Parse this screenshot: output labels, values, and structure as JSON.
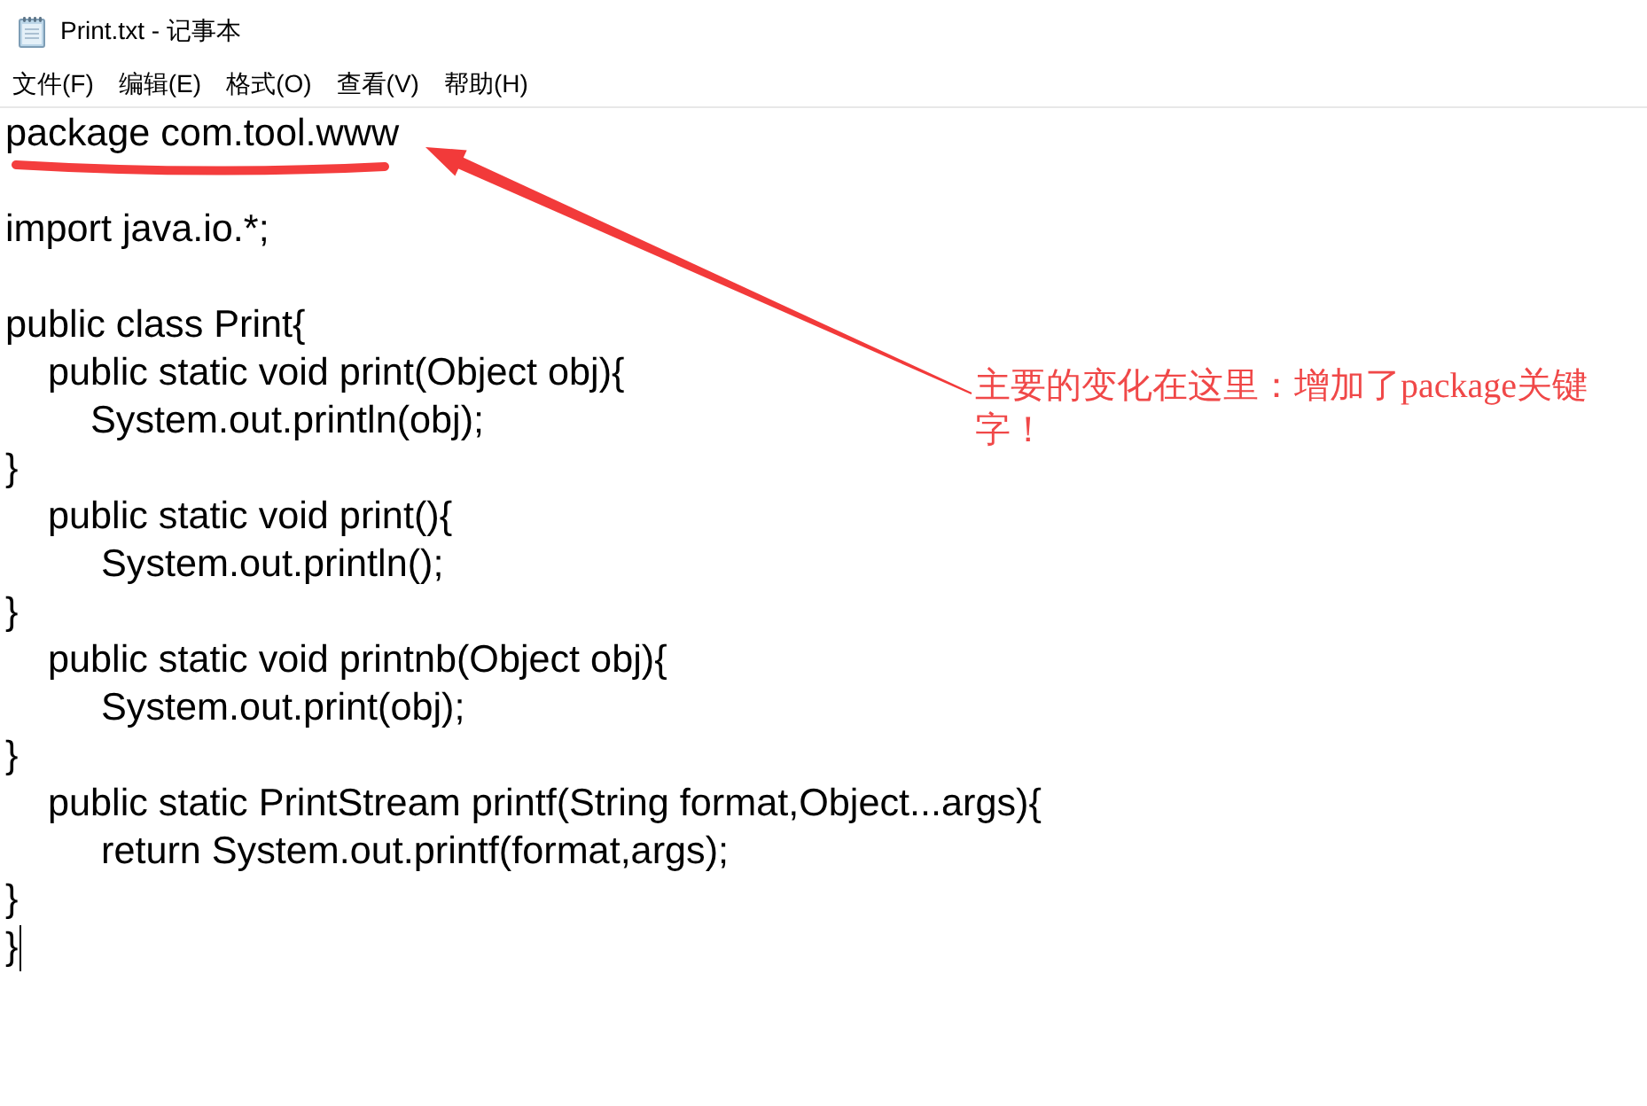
{
  "window": {
    "title": "Print.txt - 记事本"
  },
  "menu": [
    "文件(F)",
    "编辑(E)",
    "格式(O)",
    "查看(V)",
    "帮助(H)"
  ],
  "editor": {
    "caret": true,
    "blocks": [
      [
        "package com.tool.www"
      ],
      [
        "import java.io.*;"
      ],
      [
        "public class Print{",
        "    public static void print(Object obj){",
        "        System.out.println(obj);",
        "}",
        "    public static void print(){",
        "         System.out.println();",
        "}",
        "    public static void printnb(Object obj){",
        "         System.out.print(obj);",
        "}",
        "    public static PrintStream printf(String format,Object...args){",
        "         return System.out.printf(format,args);",
        "}",
        "}"
      ]
    ]
  },
  "annotation": {
    "text": "主要的变化在这里：增加了package关键字！"
  }
}
